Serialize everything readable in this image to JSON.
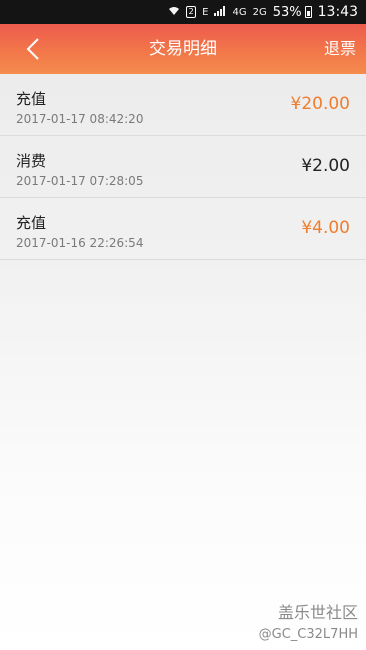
{
  "status_bar": {
    "network_e": "E",
    "network_4g": "4G",
    "network_2g": "2G",
    "sim_slot": "2",
    "battery": "53%",
    "time": "13:43"
  },
  "header": {
    "title": "交易明细",
    "refund": "退票",
    "back_icon": "chevron-left-icon"
  },
  "transactions": [
    {
      "type": "充值",
      "date": "2017-01-17 08:42:20",
      "amount": "¥20.00",
      "color": "#f07d2e"
    },
    {
      "type": "消费",
      "date": "2017-01-17 07:28:05",
      "amount": "¥2.00",
      "color": "#222222"
    },
    {
      "type": "充值",
      "date": "2017-01-16 22:26:54",
      "amount": "¥4.00",
      "color": "#f07d2e"
    }
  ],
  "watermark": {
    "line1": "盖乐世社区",
    "line2": "@GC_C32L7HH"
  },
  "colors": {
    "header_gradient_top": "#ee5b4e",
    "header_gradient_bottom": "#f48b4c",
    "amount_accent": "#f07d2e"
  }
}
